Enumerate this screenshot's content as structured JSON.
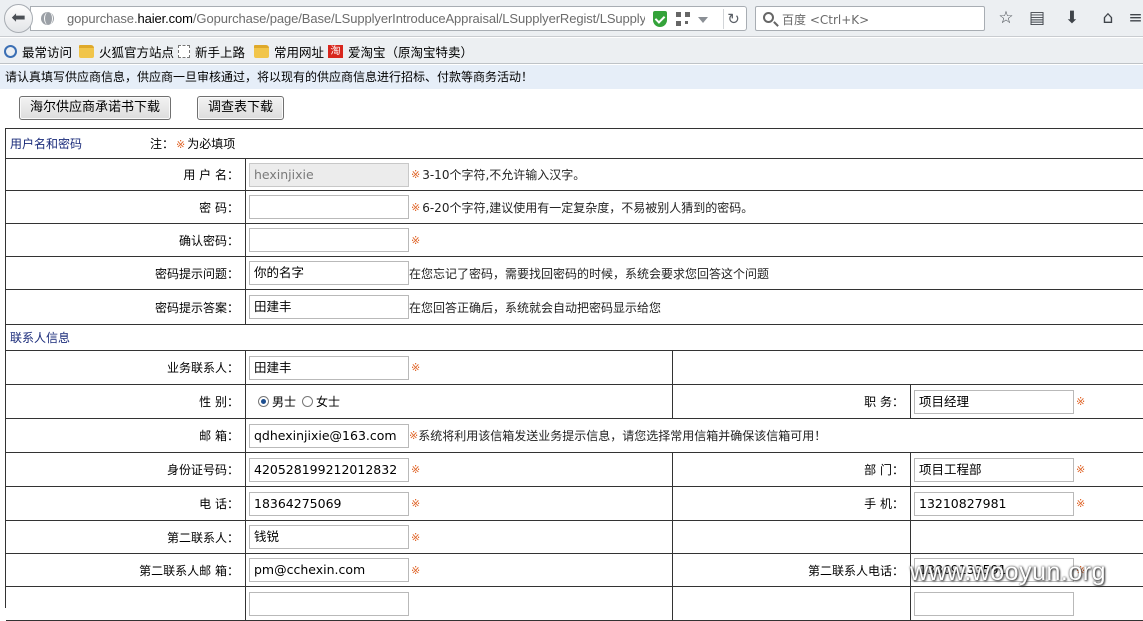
{
  "browser": {
    "url_prefix": "gopurchase.",
    "url_domain": "haier.com",
    "url_path": "/Gopurchase/page/Base/LSupplyerIntroduceAppraisal/LSupplyerRegist/LSupplyerRegist",
    "search_placeholder": "百度 <Ctrl+K>",
    "bookmarks": [
      "最常访问",
      "火狐官方站点",
      "新手上路",
      "常用网址",
      "爱淘宝（原淘宝特卖）"
    ]
  },
  "page": {
    "notice": "请认真填写供应商信息，供应商一旦审核通过，将以现有的供应商信息进行招标、付款等商务活动！",
    "buttons": {
      "commitment": "海尔供应商承诺书下载",
      "survey": "调查表下载"
    },
    "required_mark": "※",
    "account": {
      "section": "用户名和密码",
      "note_prefix": "注：",
      "note_suffix": "为必填项",
      "username_label": "用 户 名：",
      "username_value": "hexinjixie",
      "username_hint": "3-10个字符,不允许输入汉字。",
      "password_label": "密    码：",
      "password_value": "",
      "password_hint": "6-20个字符,建议使用有一定复杂度，不易被别人猜到的密码。",
      "confirm_label": "确认密码：",
      "question_label": "密码提示问题：",
      "question_value": "你的名字",
      "question_hint": "在您忘记了密码，需要找回密码的时候，系统会要求您回答这个问题",
      "answer_label": "密码提示答案：",
      "answer_value": "田建丰",
      "answer_hint": "在您回答正确后，系统就会自动把密码显示给您"
    },
    "contact": {
      "section": "联系人信息",
      "business_label": "业务联系人：",
      "business_value": "田建丰",
      "gender_label": "性    别：",
      "gender_male": "男士",
      "gender_female": "女士",
      "position_label": "职    务：",
      "position_value": "项目经理",
      "email_label": "邮    箱：",
      "email_value": "qdhexinjixie@163.com",
      "email_hint": "系统将利用该信箱发送业务提示信息，请您选择常用信箱并确保该信箱可用！",
      "id_label": "身份证号码：",
      "id_value": "420528199212012832",
      "dept_label": "部    门：",
      "dept_value": "项目工程部",
      "phone_label": "电    话：",
      "phone_value": "18364275069",
      "mobile_label": "手    机：",
      "mobile_value": "13210827981",
      "second_label": "第二联系人：",
      "second_value": "钱锐",
      "second_email_label": "第二联系人邮 箱：",
      "second_email_value": "pm@cchexin.com",
      "second_phone_label": "第二联系人电话：",
      "second_phone_value": "13869133591"
    }
  },
  "watermark": "www.wooyun.org"
}
